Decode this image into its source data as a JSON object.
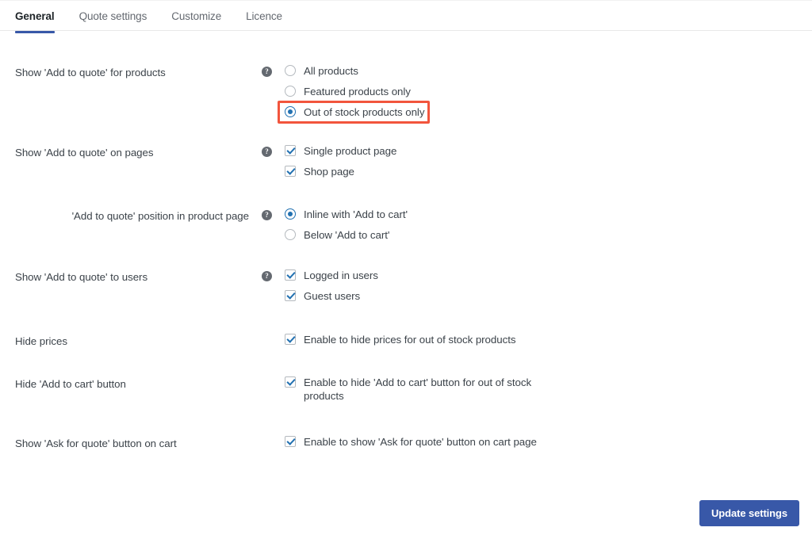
{
  "tabs": [
    {
      "label": "General",
      "active": true
    },
    {
      "label": "Quote settings",
      "active": false
    },
    {
      "label": "Customize",
      "active": false
    },
    {
      "label": "Licence",
      "active": false
    }
  ],
  "colors": {
    "accent_blue": "#3858a8",
    "control_blue": "#2271b1",
    "highlight_red": "#f2553d",
    "text": "#3c434a",
    "muted_text": "#646970",
    "border": "#e8e8e8"
  },
  "help_icon_glyph": "?",
  "sections": [
    {
      "label": "Show 'Add to quote' for products",
      "has_help": true,
      "indented": false,
      "type": "radio",
      "options": [
        {
          "text": "All products",
          "checked": false,
          "highlighted": false
        },
        {
          "text": "Featured products only",
          "checked": false,
          "highlighted": false
        },
        {
          "text": "Out of stock products only",
          "checked": true,
          "highlighted": true
        }
      ]
    },
    {
      "label": "Show 'Add to quote' on pages",
      "has_help": true,
      "indented": false,
      "type": "checkbox",
      "options": [
        {
          "text": "Single product page",
          "checked": true,
          "highlighted": false
        },
        {
          "text": "Shop page",
          "checked": true,
          "highlighted": false
        }
      ]
    },
    {
      "label": "'Add to quote' position in product page",
      "has_help": true,
      "indented": true,
      "type": "radio",
      "options": [
        {
          "text": "Inline with 'Add to cart'",
          "checked": true,
          "highlighted": false
        },
        {
          "text": "Below 'Add to cart'",
          "checked": false,
          "highlighted": false
        }
      ]
    },
    {
      "label": "Show 'Add to quote' to users",
      "has_help": true,
      "indented": false,
      "type": "checkbox",
      "options": [
        {
          "text": "Logged in users",
          "checked": true,
          "highlighted": false
        },
        {
          "text": "Guest users",
          "checked": true,
          "highlighted": false
        }
      ]
    },
    {
      "label": "Hide prices",
      "has_help": false,
      "indented": false,
      "type": "checkbox",
      "options": [
        {
          "text": "Enable to hide prices for out of stock products",
          "checked": true,
          "highlighted": false
        }
      ]
    },
    {
      "label": "Hide 'Add to cart' button",
      "has_help": false,
      "indented": false,
      "type": "checkbox",
      "options": [
        {
          "text": "Enable to hide 'Add to cart' button for out of stock products",
          "checked": true,
          "highlighted": false
        }
      ]
    },
    {
      "label": "Show 'Ask for quote' button on cart",
      "has_help": false,
      "indented": false,
      "type": "checkbox",
      "options": [
        {
          "text": "Enable to show 'Ask for quote' button on cart page",
          "checked": true,
          "highlighted": false
        }
      ]
    }
  ],
  "footer": {
    "submit_label": "Update settings"
  }
}
